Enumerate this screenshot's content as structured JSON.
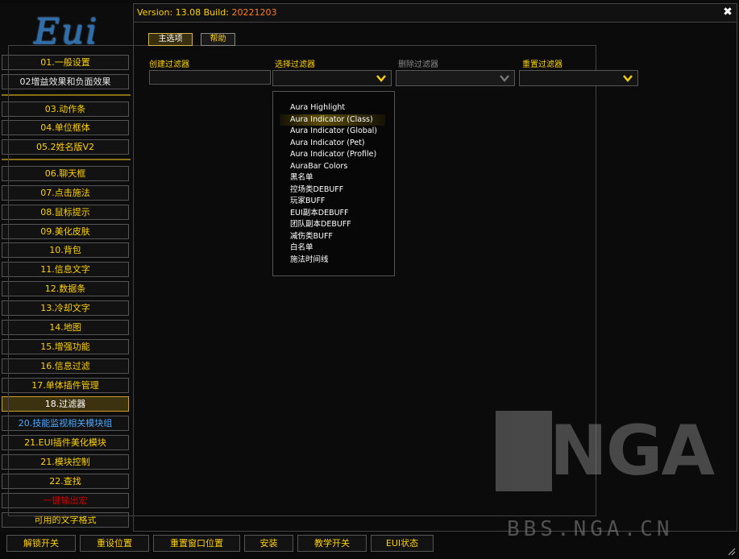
{
  "app": {
    "logo_text": "Eui"
  },
  "header": {
    "version_label": "Version: 13.08 Build: ",
    "build": "20221203"
  },
  "sidebar": {
    "items": [
      {
        "label": "01.一般设置",
        "style": "normal"
      },
      {
        "label": "02增益效果和负面效果",
        "style": "white"
      },
      {
        "label": "03.动作条",
        "style": "normal"
      },
      {
        "label": "04.单位框体",
        "style": "normal"
      },
      {
        "label": "05.2姓名版V2",
        "style": "normal"
      },
      {
        "label": "06.聊天框",
        "style": "normal"
      },
      {
        "label": "07.点击施法",
        "style": "normal"
      },
      {
        "label": "08.鼠标提示",
        "style": "normal"
      },
      {
        "label": "09.美化皮肤",
        "style": "normal"
      },
      {
        "label": "10.背包",
        "style": "normal"
      },
      {
        "label": "11.信息文字",
        "style": "normal"
      },
      {
        "label": "12.数据条",
        "style": "normal"
      },
      {
        "label": "13.冷却文字",
        "style": "normal"
      },
      {
        "label": "14.地图",
        "style": "normal"
      },
      {
        "label": "15.增强功能",
        "style": "normal"
      },
      {
        "label": "16.信息过滤",
        "style": "normal"
      },
      {
        "label": "17.单体插件管理",
        "style": "normal"
      },
      {
        "label": "18.过滤器",
        "style": "active"
      },
      {
        "label": "20.技能监视相关模块组",
        "style": "blue"
      },
      {
        "label": "21.EUI插件美化模块",
        "style": "normal"
      },
      {
        "label": "21.模块控制",
        "style": "normal"
      },
      {
        "label": "22.查找",
        "style": "normal"
      },
      {
        "label": "一键输出宏",
        "style": "red"
      },
      {
        "label": "可用的文字格式",
        "style": "normal"
      }
    ]
  },
  "tabs": [
    {
      "label": "主选项",
      "active": true
    },
    {
      "label": "帮助",
      "active": false
    }
  ],
  "fields": {
    "create_filter": {
      "label": "创建过滤器",
      "value": ""
    },
    "select_filter": {
      "label": "选择过滤器",
      "value": ""
    },
    "delete_filter": {
      "label": "删除过滤器",
      "value": "",
      "disabled": true
    },
    "reset_filter": {
      "label": "重置过滤器",
      "value": ""
    }
  },
  "select_menu": {
    "options": [
      "Aura Highlight",
      "Aura Indicator (Class)",
      "Aura Indicator (Global)",
      "Aura Indicator (Pet)",
      "Aura Indicator (Profile)",
      "AuraBar Colors",
      "黑名单",
      "控场类DEBUFF",
      "玩家BUFF",
      "EUI副本DEBUFF",
      "团队副本DEBUFF",
      "减伤类BUFF",
      "白名单",
      "施法时间线"
    ],
    "highlighted_index": 1
  },
  "bottom_bar": {
    "buttons": [
      "解锁开关",
      "重设位置",
      "重置窗口位置",
      "安装",
      "教学开关",
      "EUI状态"
    ]
  },
  "watermark": {
    "logo": "NGA",
    "site": "BBS.NGA.CN"
  },
  "colors": {
    "gold": "#ffd200",
    "build": "#ff7f24",
    "blue": "#4aa8ff",
    "red": "#d10000",
    "border": "#555555"
  }
}
